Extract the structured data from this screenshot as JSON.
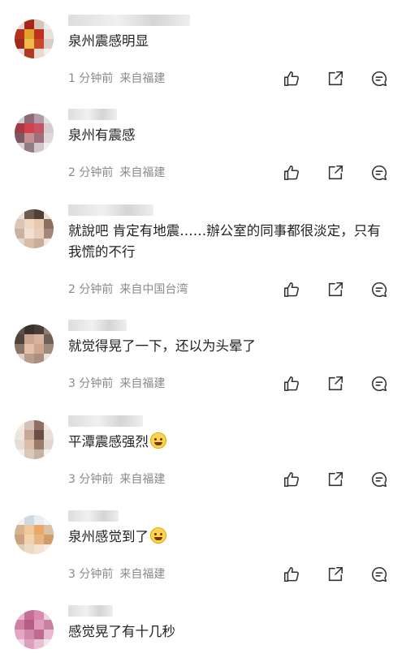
{
  "comments": [
    {
      "text": "泉州震感明显",
      "time": "1 分钟前",
      "location": "来自福建"
    },
    {
      "text": "泉州有震感",
      "time": "2 分钟前",
      "location": "来自福建"
    },
    {
      "text": "就說吧 肯定有地震……辦公室的同事都很淡定，只有我慌的不行",
      "time": "2 分钟前",
      "location": "来自中国台湾"
    },
    {
      "text": "就觉得晃了一下，还以为头晕了",
      "time": "3 分钟前",
      "location": "来自福建"
    },
    {
      "text": "平潭震感强烈",
      "time": "3 分钟前",
      "location": "来自福建",
      "emoji": "laugh-cry-emoji"
    },
    {
      "text": "泉州感觉到了",
      "time": "3 分钟前",
      "location": "来自福建",
      "emoji": "crying-emoji"
    },
    {
      "text": "感觉晃了有十几秒"
    }
  ],
  "icons": {
    "like": "thumbs-up-icon",
    "repost": "share-arrow-icon",
    "reply": "comment-bubble-icon"
  },
  "colors": {
    "text": "#222222",
    "meta": "#8a8a8a",
    "icon": "#333333",
    "background": "#ffffff"
  }
}
